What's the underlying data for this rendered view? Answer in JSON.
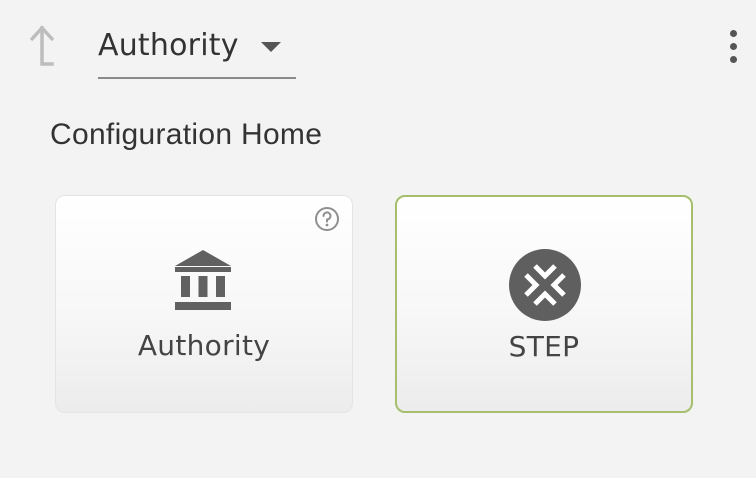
{
  "header": {
    "up_icon": "arrow-up-icon",
    "selector_value": "Authority",
    "menu_icon": "more-vertical-icon"
  },
  "page": {
    "title": "Configuration Home"
  },
  "tiles": [
    {
      "label": "Authority",
      "icon": "institution-icon",
      "help_icon": "help-circle-icon",
      "selected": false
    },
    {
      "label": "STEP",
      "icon": "step-logo-icon",
      "selected": true,
      "accent": "#a6be6e"
    }
  ]
}
